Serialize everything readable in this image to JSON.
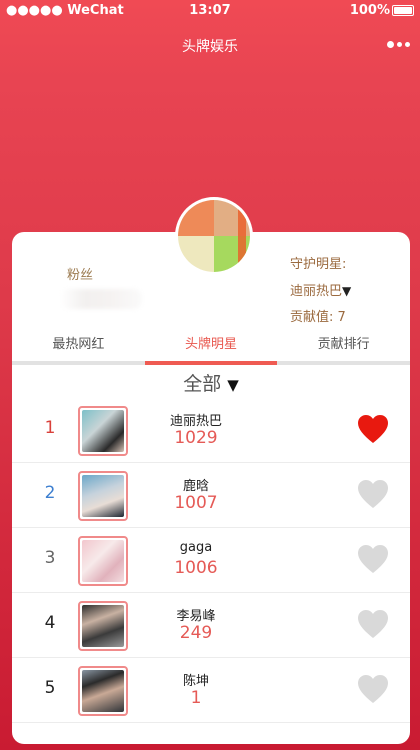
{
  "status_bar": {
    "carrier": "●●●●● WeChat",
    "time": "13:07",
    "battery": "100%"
  },
  "nav": {
    "title": "头牌娱乐",
    "more_icon": "more-dots-icon"
  },
  "profile": {
    "fans_label": "粉丝",
    "guard_label": "守护明星:",
    "guard_star": "迪丽热巴",
    "contribution_label": "贡献值: 7"
  },
  "tabs": [
    {
      "label": "最热网红"
    },
    {
      "label": "头牌明星"
    },
    {
      "label": "贡献排行"
    }
  ],
  "filter": {
    "label": "全部"
  },
  "ranking": [
    {
      "rank": "1",
      "name": "迪丽热巴",
      "score": "1029",
      "liked": true,
      "rank_color": "#d9403a"
    },
    {
      "rank": "2",
      "name": "鹿晗",
      "score": "1007",
      "liked": false,
      "rank_color": "#3d7fd0"
    },
    {
      "rank": "3",
      "name": "gaga",
      "score": "1006",
      "liked": false,
      "rank_color": "#666666"
    },
    {
      "rank": "4",
      "name": "李易峰",
      "score": "249",
      "liked": false,
      "rank_color": "#222222"
    },
    {
      "rank": "5",
      "name": "陈坤",
      "score": "1",
      "liked": false,
      "rank_color": "#222222"
    }
  ],
  "colors": {
    "accent": "#ef5b52",
    "heart_active": "#e8190f",
    "heart_inactive": "#d9d9d9",
    "score": "#e55a56"
  }
}
